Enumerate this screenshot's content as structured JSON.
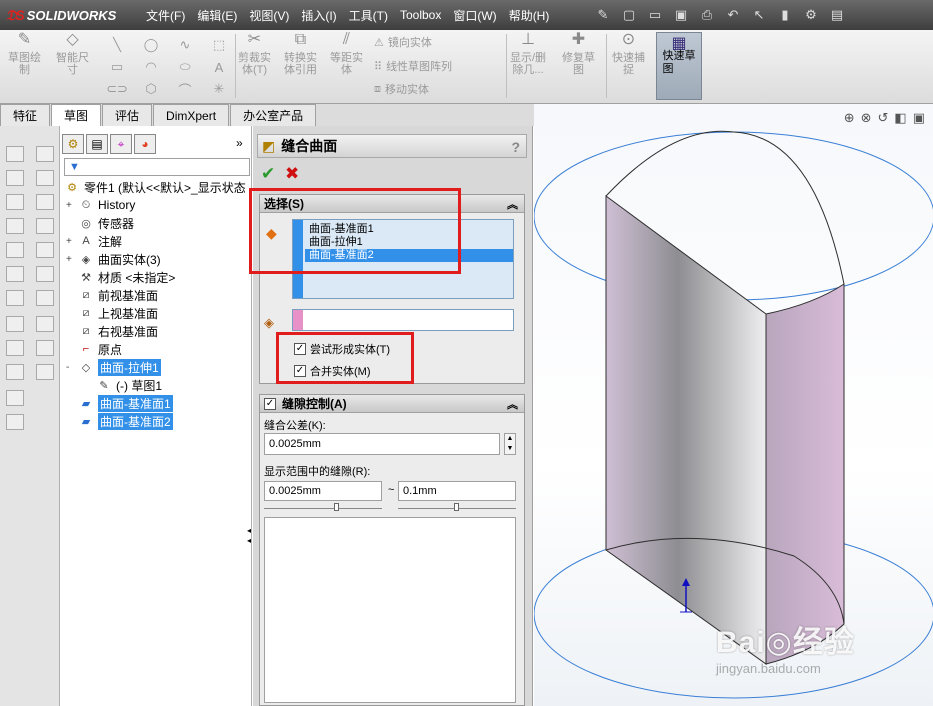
{
  "app": {
    "brand": "SOLIDWORKS"
  },
  "menu": [
    "文件(F)",
    "编辑(E)",
    "视图(V)",
    "插入(I)",
    "工具(T)",
    "Toolbox",
    "窗口(W)",
    "帮助(H)"
  ],
  "ribbon": {
    "sketch_label": "草图绘\n制",
    "smart_dim_label": "智能尺\n寸",
    "trim_label": "剪裁实\n体(T)",
    "convert_label": "转换实\n体引用",
    "offset_label": "等距实\n体",
    "mirror_label": "镜向实体",
    "linear_pattern_label": "线性草图阵列",
    "move_label": "移动实体",
    "display_delete_label": "显示/删\n除几...",
    "repair_label": "修复草\n图",
    "rapid_snap_label": "快速捕\n捉",
    "quick_sketch_label": "快速草\n图"
  },
  "tabs": [
    "特征",
    "草图",
    "评估",
    "DimXpert",
    "办公室产品"
  ],
  "active_tab": "草图",
  "tree": {
    "root": "零件1 (默认<<默认>_显示状态",
    "items": [
      {
        "label": "History",
        "expander": "+",
        "icon": "history-icon"
      },
      {
        "label": "传感器",
        "expander": "",
        "icon": "sensor-icon"
      },
      {
        "label": "注解",
        "expander": "+",
        "icon": "annotation-icon"
      },
      {
        "label": "曲面实体(3)",
        "expander": "+",
        "icon": "surface-bodies-icon"
      },
      {
        "label": "材质 <未指定>",
        "expander": "",
        "icon": "material-icon"
      },
      {
        "label": "前视基准面",
        "expander": "",
        "icon": "plane-icon"
      },
      {
        "label": "上视基准面",
        "expander": "",
        "icon": "plane-icon"
      },
      {
        "label": "右视基准面",
        "expander": "",
        "icon": "plane-icon"
      },
      {
        "label": "原点",
        "expander": "",
        "icon": "origin-icon"
      },
      {
        "label": "曲面-拉伸1",
        "expander": "-",
        "icon": "surface-extrude-icon",
        "selected": true
      },
      {
        "label": "(-) 草图1",
        "expander": "",
        "icon": "sketch-icon",
        "child": true
      },
      {
        "label": "曲面-基准面1",
        "expander": "",
        "icon": "planar-surface-icon",
        "selected": true
      },
      {
        "label": "曲面-基准面2",
        "expander": "",
        "icon": "planar-surface-icon",
        "selected": true
      }
    ]
  },
  "pm": {
    "title": "缝合曲面",
    "help": "?",
    "selection_header": "选择(S)",
    "selection_items": [
      "曲面-基准面1",
      "曲面-拉伸1",
      "曲面-基准面2"
    ],
    "highlighted_index": 2,
    "try_form_solid": "尝试形成实体(T)",
    "merge_entities": "合并实体(M)",
    "gap_header": "缝隙控制(A)",
    "tolerance_label": "缝合公差(K):",
    "tolerance_value": "0.0025mm",
    "range_label": "显示范围中的缝隙(R):",
    "range_min": "0.0025mm",
    "range_sep": "~",
    "range_max": "0.1mm"
  },
  "watermark": {
    "logo": "Bai◎经验",
    "url": "jingyan.baidu.com"
  },
  "colors": {
    "highlight": "#3390e8",
    "annotation_red": "#e01c1c",
    "surface_purple": "#c7aec8",
    "edge_blue": "#3a7fd6"
  }
}
